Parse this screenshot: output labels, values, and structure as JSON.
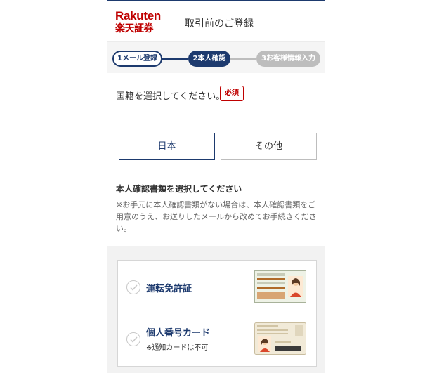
{
  "header": {
    "logo_en": "Rakuten",
    "logo_jp": "楽天証券",
    "title": "取引前のご登録"
  },
  "stepper": {
    "steps": [
      {
        "label": "1メール登録",
        "state": "done"
      },
      {
        "label": "2本人確認",
        "state": "active"
      },
      {
        "label": "3お客様情報入力",
        "state": "todo"
      }
    ]
  },
  "nationality": {
    "question": "国籍を選択してください。",
    "required_badge": "必須",
    "options": [
      {
        "label": "日本",
        "selected": true
      },
      {
        "label": "その他",
        "selected": false
      }
    ]
  },
  "documents": {
    "heading": "本人確認書類を選択してください",
    "note": "※お手元に本人確認書類がない場合は、本人確認書類をご用意のうえ、お送りしたメールから改めてお手続きください。",
    "items": [
      {
        "title": "運転免許証",
        "sub": "",
        "image": "drivers-license-image"
      },
      {
        "title": "個人番号カード",
        "sub": "※通知カードは不可",
        "image": "my-number-card-image"
      }
    ]
  },
  "colors": {
    "brand_red": "#bf0000",
    "navy": "#1d3a6e",
    "inactive_gray": "#bdbdbd"
  }
}
